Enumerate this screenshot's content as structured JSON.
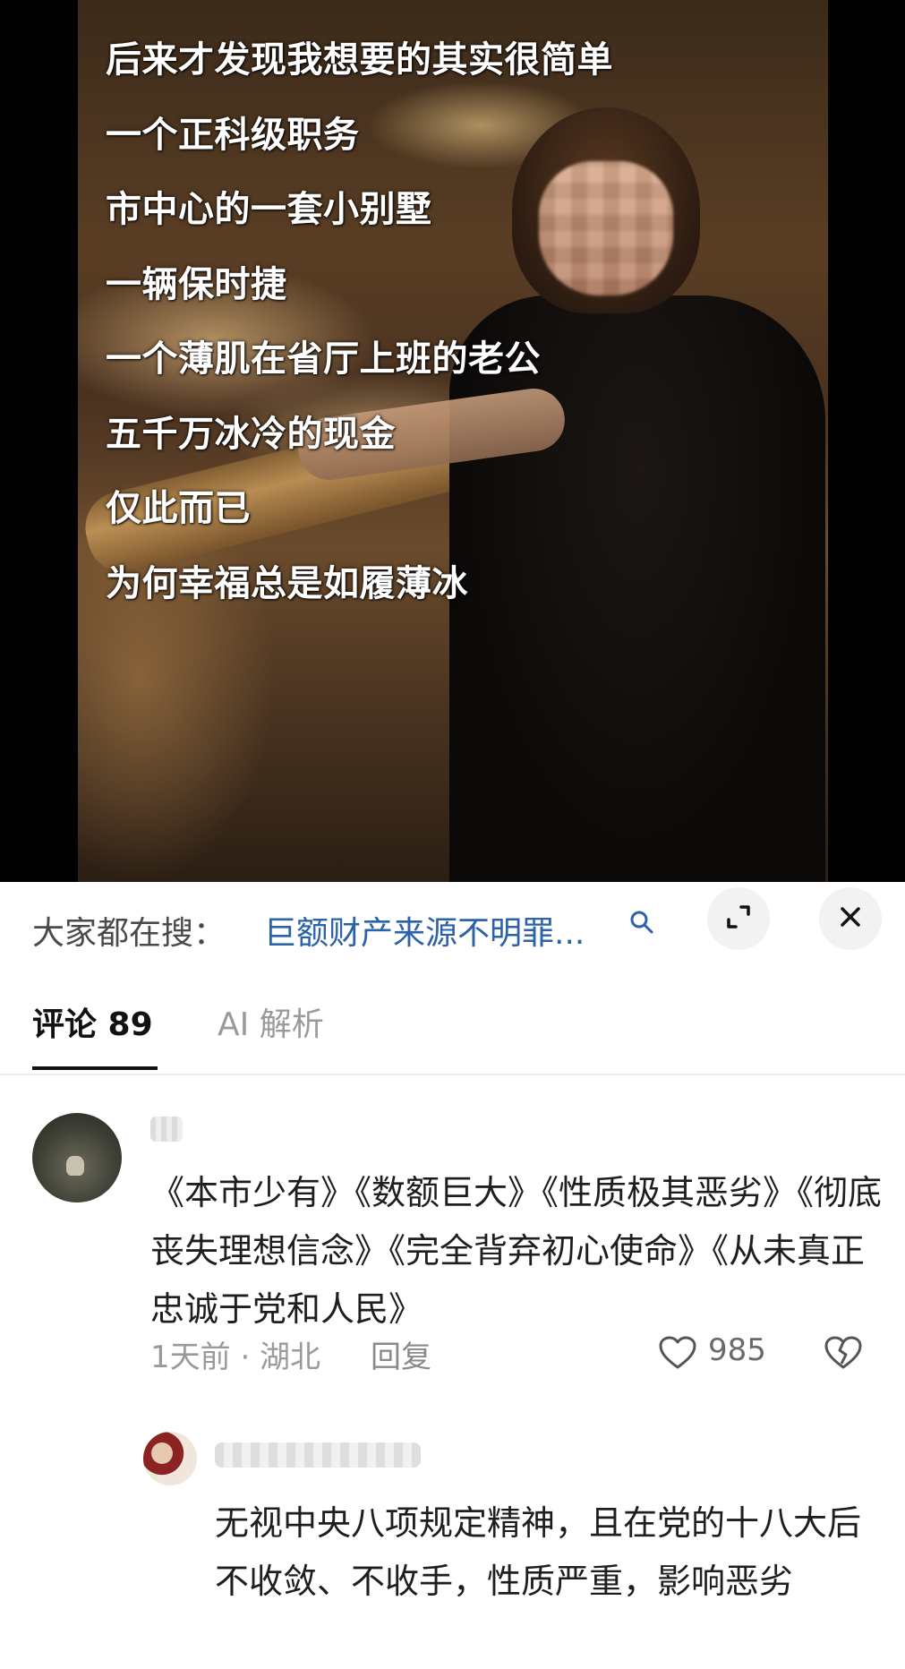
{
  "media": {
    "poem_lines": [
      "后来才发现我想要的其实很简单",
      "一个正科级职务",
      "市中心的一套小别墅",
      "一辆保时捷",
      "一个薄肌在省厅上班的老公",
      "五千万冰冷的现金",
      "仅此而已",
      "为何幸福总是如履薄冰"
    ]
  },
  "search_bar": {
    "label": "大家都在搜：",
    "query": "巨额财产来源不明罪...",
    "search_icon": "search-icon",
    "expand_icon": "expand-icon",
    "close_icon": "close-icon"
  },
  "tabs": {
    "comments_label": "评论 89",
    "ai_label": "AI 解析"
  },
  "comment": {
    "text": "《本市少有》《数额巨大》《性质极其恶劣》《彻底丧失理想信念》《完全背弃初心使命》《从未真正忠诚于党和人民》",
    "meta": "1天前 · 湖北",
    "reply_label": "回复",
    "likes": "985",
    "like_icon": "heart-icon",
    "dislike_icon": "broken-heart-icon"
  },
  "reply": {
    "text": "无视中央八项规定精神，且在党的十八大后不收敛、不收手，性质严重，影响恶劣"
  },
  "colors": {
    "link_blue": "#2b62a8",
    "text_dark": "#1e1e1e",
    "text_gray": "#9a9a9a"
  }
}
